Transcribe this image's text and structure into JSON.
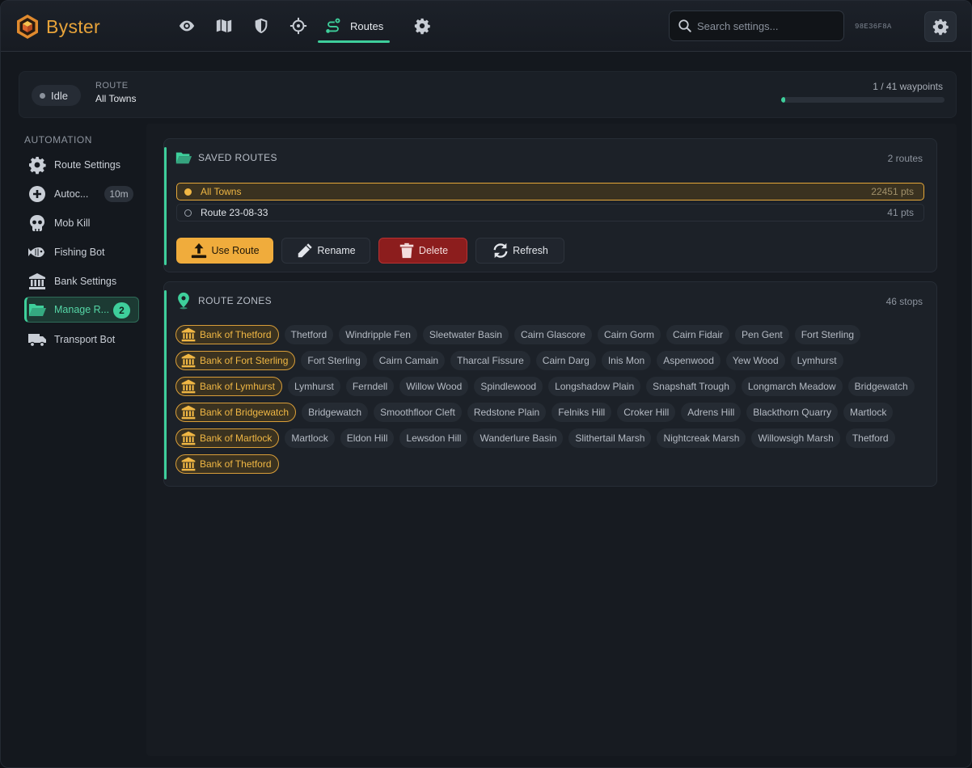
{
  "app": {
    "name": "Byster",
    "hwid": "98E36F8A",
    "search_placeholder": "Search settings...",
    "colors": {
      "accent": "#3ecf9b",
      "brand": "#e7a33a",
      "bank": "#f0b744",
      "danger": "#8c1d1d"
    }
  },
  "nav": {
    "icons": [
      "eye-icon",
      "map-icon",
      "shield-icon",
      "crosshair-icon"
    ],
    "active_label": "Routes",
    "trailing_icon": "gear-icon"
  },
  "status": {
    "state": "Idle",
    "route_kicker": "ROUTE",
    "route_name": "All Towns",
    "waypoints": "1 / 41 waypoints",
    "progress_fraction": 0.024
  },
  "sidebar": {
    "heading": "AUTOMATION",
    "items": [
      {
        "label": "Route Settings",
        "icon": "gear-icon"
      },
      {
        "label": "Autoc...",
        "icon": "plus-circle-icon",
        "badge": "10m"
      },
      {
        "label": "Mob Kill",
        "icon": "skull-icon"
      },
      {
        "label": "Fishing Bot",
        "icon": "fish-icon"
      },
      {
        "label": "Bank Settings",
        "icon": "bank-icon"
      },
      {
        "label": "Manage R...",
        "icon": "folder-open-icon",
        "badge": "2",
        "active": true
      },
      {
        "label": "Transport Bot",
        "icon": "truck-icon"
      }
    ]
  },
  "saved_routes": {
    "title": "SAVED ROUTES",
    "count": "2 routes",
    "routes": [
      {
        "name": "All Towns",
        "pts": "22451 pts",
        "selected": true
      },
      {
        "name": "Route 23-08-33",
        "pts": "41 pts",
        "selected": false
      }
    ],
    "buttons": {
      "use": "Use Route",
      "rename": "Rename",
      "delete": "Delete",
      "refresh": "Refresh"
    }
  },
  "route_zones": {
    "title": "ROUTE ZONES",
    "count": "46 stops",
    "zones": [
      {
        "name": "Bank of Thetford",
        "bank": true
      },
      {
        "name": "Thetford"
      },
      {
        "name": "Windripple Fen"
      },
      {
        "name": "Sleetwater Basin"
      },
      {
        "name": "Cairn Glascore"
      },
      {
        "name": "Cairn Gorm"
      },
      {
        "name": "Cairn Fidair"
      },
      {
        "name": "Pen Gent"
      },
      {
        "name": "Fort Sterling"
      },
      {
        "name": "Bank of Fort Sterling",
        "bank": true
      },
      {
        "name": "Fort Sterling"
      },
      {
        "name": "Cairn Camain"
      },
      {
        "name": "Tharcal Fissure"
      },
      {
        "name": "Cairn Darg"
      },
      {
        "name": "Inis Mon"
      },
      {
        "name": "Aspenwood"
      },
      {
        "name": "Yew Wood"
      },
      {
        "name": "Lymhurst"
      },
      {
        "name": "Bank of Lymhurst",
        "bank": true
      },
      {
        "name": "Lymhurst"
      },
      {
        "name": "Ferndell"
      },
      {
        "name": "Willow Wood"
      },
      {
        "name": "Spindlewood"
      },
      {
        "name": "Longshadow Plain"
      },
      {
        "name": "Snapshaft Trough"
      },
      {
        "name": "Longmarch Meadow"
      },
      {
        "name": "Bridgewatch"
      },
      {
        "name": "Bank of Bridgewatch",
        "bank": true
      },
      {
        "name": "Bridgewatch"
      },
      {
        "name": "Smoothfloor Cleft"
      },
      {
        "name": "Redstone Plain"
      },
      {
        "name": "Felniks Hill"
      },
      {
        "name": "Croker Hill"
      },
      {
        "name": "Adrens Hill"
      },
      {
        "name": "Blackthorn Quarry"
      },
      {
        "name": "Martlock"
      },
      {
        "name": "Bank of Martlock",
        "bank": true
      },
      {
        "name": "Martlock"
      },
      {
        "name": "Eldon Hill"
      },
      {
        "name": "Lewsdon Hill"
      },
      {
        "name": "Wanderlure Basin"
      },
      {
        "name": "Slithertail Marsh"
      },
      {
        "name": "Nightcreak Marsh"
      },
      {
        "name": "Willowsigh Marsh"
      },
      {
        "name": "Thetford"
      },
      {
        "name": "Bank of Thetford",
        "bank": true
      }
    ]
  }
}
